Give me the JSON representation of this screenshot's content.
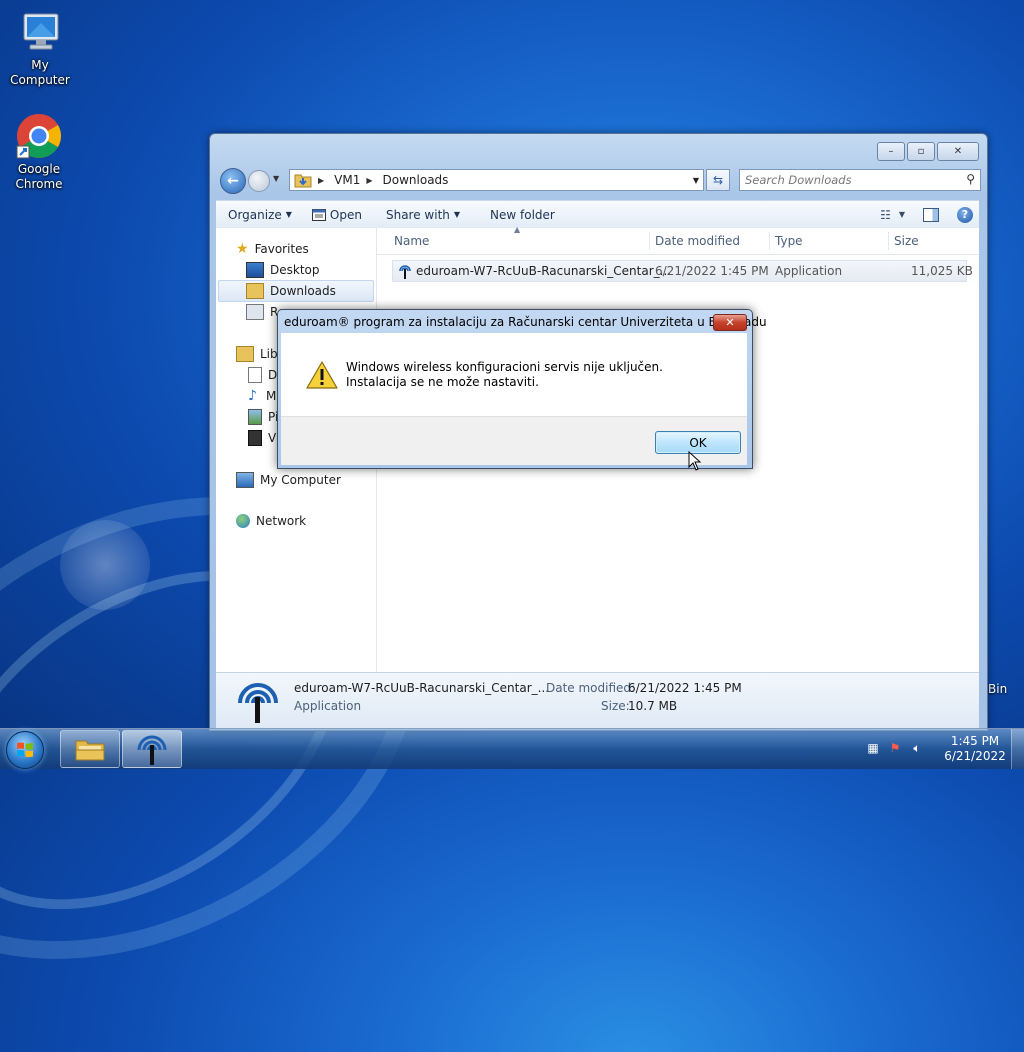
{
  "desktop": {
    "icons": [
      {
        "label": "My Computer"
      },
      {
        "label": "Google Chrome"
      }
    ],
    "recycle_label": "Bin"
  },
  "explorer": {
    "window_controls": {
      "minimize": "–",
      "maximize": "▫",
      "close": "✕"
    },
    "address": {
      "segments": [
        "VM1",
        "Downloads"
      ]
    },
    "search_placeholder": "Search Downloads",
    "toolbar": {
      "organize": "Organize",
      "open": "Open",
      "share_with": "Share with",
      "new_folder": "New folder"
    },
    "nav": {
      "favorites": "Favorites",
      "desktop": "Desktop",
      "downloads": "Downloads",
      "recent_partial": "Re",
      "libraries_partial": "Libr",
      "lib_items_partial": [
        "D",
        "M",
        "Pi",
        "Vi"
      ],
      "my_computer": "My Computer",
      "network": "Network"
    },
    "columns": {
      "name": "Name",
      "date_modified": "Date modified",
      "type": "Type",
      "size": "Size"
    },
    "file": {
      "name": "eduroam-W7-RcUuB-Racunarski_Centar_...",
      "date": "6/21/2022 1:45 PM",
      "type": "Application",
      "size": "11,025 KB"
    },
    "details": {
      "name": "eduroam-W7-RcUuB-Racunarski_Centar_...",
      "kind": "Application",
      "date_label": "Date modified:",
      "date_value": "6/21/2022 1:45 PM",
      "size_label": "Size:",
      "size_value": "10.7 MB"
    }
  },
  "dialog": {
    "title": "eduroam® program za instalaciju za Računarski centar Univerziteta u Beogradu",
    "close": "✕",
    "message": "Windows wireless konfiguracioni servis nije uključen. Instalacija se ne može nastaviti.",
    "ok_label": "OK"
  },
  "taskbar": {
    "time": "1:45 PM",
    "date": "6/21/2022"
  }
}
